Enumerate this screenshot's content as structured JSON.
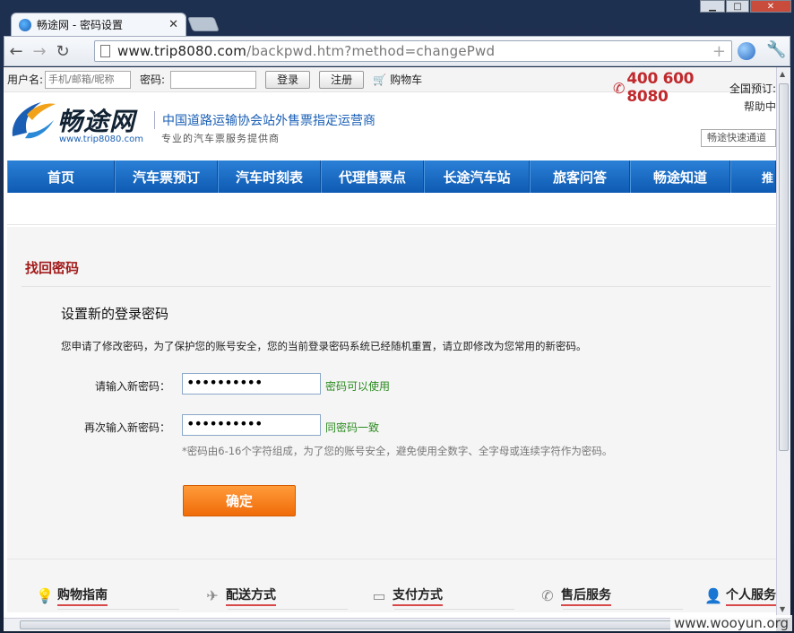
{
  "browser": {
    "tab_title": "畅途网 - 密码设置",
    "url_host": "www.trip8080.com",
    "url_path": "/backpwd.htm?method=changePwd"
  },
  "loginbar": {
    "username_label": "用户名:",
    "username_placeholder": "手机/邮箱/昵称",
    "password_label": "密码:",
    "login_button": "登录",
    "register_button": "注册",
    "cart_label": "购物车",
    "hotline": "400 600 8080",
    "hotline_tail": "全国预订:"
  },
  "header": {
    "logo_text": "畅途网",
    "logo_url": "www.trip8080.com",
    "slogan_main": "中国道路运输协会站外售票指定运营商",
    "slogan_sub": "专业的汽车票服务提供商",
    "help": "帮助中",
    "quick_channel": "畅途快速通道"
  },
  "nav": {
    "items": [
      "首页",
      "汽车票预订",
      "汽车时刻表",
      "代理售票点",
      "长途汽车站",
      "旅客问答",
      "畅途知道",
      "推"
    ]
  },
  "main": {
    "section_title": "找回密码",
    "form_title": "设置新的登录密码",
    "notice": "您申请了修改密码，为了保护您的账号安全，您的当前登录密码系统已经随机重置，请立即修改为您常用的新密码。",
    "new_pwd_label": "请输入新密码：",
    "new_pwd_value": "••••••••••",
    "new_pwd_status": "密码可以使用",
    "confirm_pwd_label": "再次输入新密码：",
    "confirm_pwd_value": "••••••••••",
    "confirm_pwd_status": "同密码一致",
    "rule_hint": "*密码由6-16个字符组成，为了您的账号安全，避免使用全数字、全字母或连续字符作为密码。",
    "submit_label": "确定"
  },
  "footer": {
    "items": [
      {
        "label": "购物指南",
        "icon": "lightbulb-icon"
      },
      {
        "label": "配送方式",
        "icon": "plane-icon"
      },
      {
        "label": "支付方式",
        "icon": "card-icon"
      },
      {
        "label": "售后服务",
        "icon": "phone-icon"
      },
      {
        "label": "个人服务",
        "icon": "person-icon"
      }
    ]
  },
  "watermark": "www.wooyun.org",
  "colors": {
    "nav_blue": "#0e5ab3",
    "accent_red": "#a31c1c",
    "success_green": "#2a8a1f",
    "button_orange": "#f06b09"
  }
}
